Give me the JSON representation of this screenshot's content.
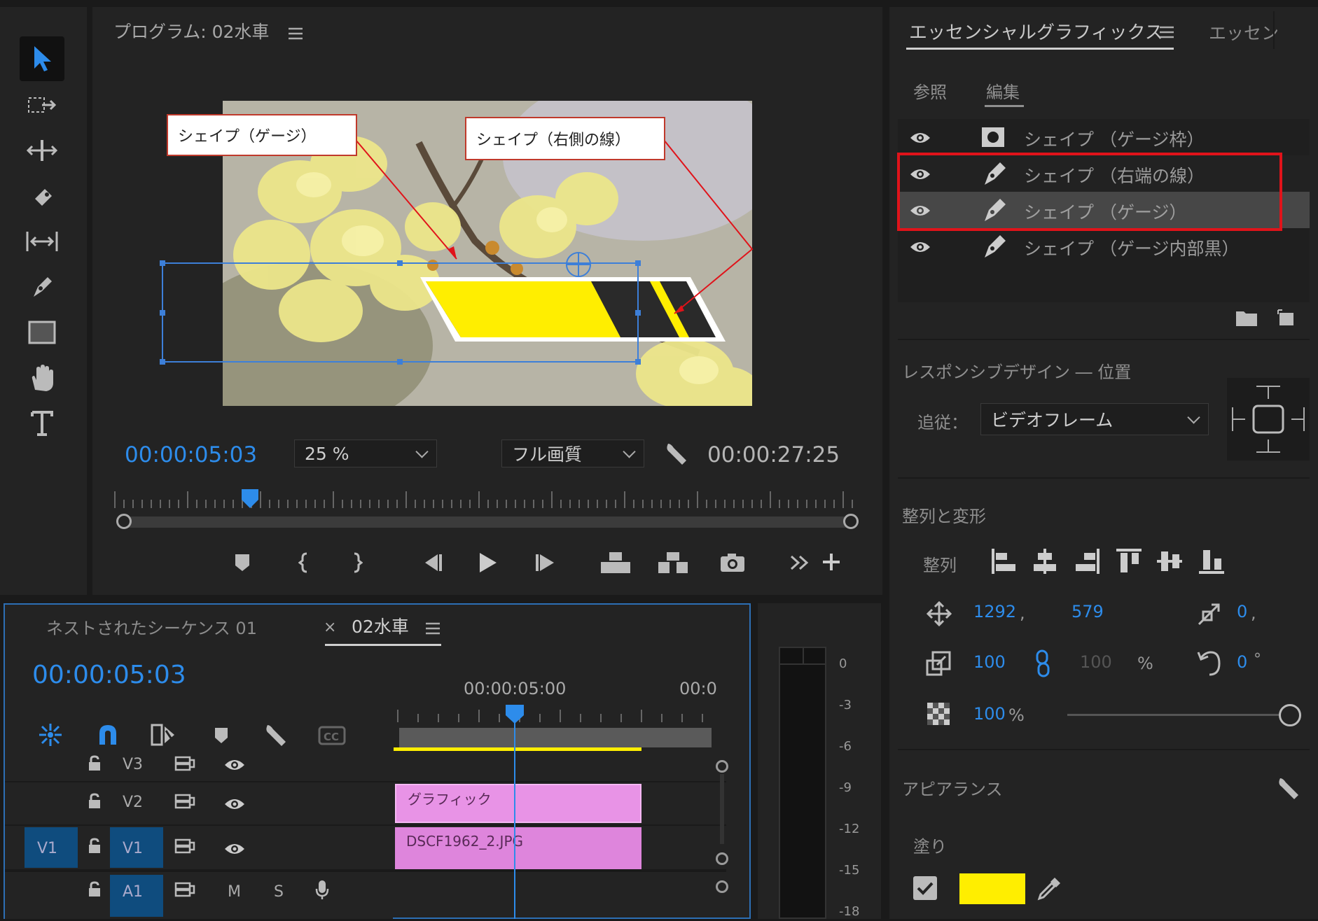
{
  "program": {
    "title": "プログラム: 02水車",
    "timecode": "00:00:05:03",
    "zoom": "25 %",
    "quality": "フル画質",
    "duration": "00:00:27:25",
    "playhead_fraction": 0.18
  },
  "callouts": {
    "gauge": "シェイプ（ゲージ）",
    "right_line": "シェイプ（右側の線）"
  },
  "essential": {
    "tab_main": "エッセンシャルグラフィックス",
    "tab_other": "エッセン",
    "subtab_browse": "参照",
    "subtab_edit": "編集",
    "layers": [
      {
        "name": "シェイプ （ゲージ枠）",
        "icon": "image-icon"
      },
      {
        "name": "シェイプ （右端の線）",
        "icon": "pen-icon"
      },
      {
        "name": "シェイプ （ゲージ）",
        "icon": "pen-icon"
      },
      {
        "name": "シェイプ （ゲージ内部黒）",
        "icon": "pen-icon"
      }
    ],
    "responsive_title": "レスポンシブデザイン ― 位置",
    "follow_label": "追従：",
    "follow_value": "ビデオフレーム",
    "align_title": "整列と変形",
    "align_label": "整列",
    "pos_x": "1292",
    "pos_sep": ",",
    "pos_y": "579",
    "anchor_x": "0",
    "anchor_sep": ",",
    "scale": "100",
    "scale_h": "100",
    "scale_unit": "%",
    "rotation": "0",
    "rotation_unit": "°",
    "opacity": "100",
    "opacity_unit": "%",
    "appearance_title": "アピアランス",
    "fill_label": "塗り",
    "fill_color": "#ffee00"
  },
  "timeline": {
    "tab_nested": "ネストされたシーケンス 01",
    "tab_close": "×",
    "tab_active": "02水車",
    "timecode": "00:00:05:03",
    "ruler_label_1": "00:00:05:00",
    "ruler_label_2": "00:0",
    "tracks": [
      {
        "target": "",
        "name": "V3",
        "type": "video"
      },
      {
        "target": "",
        "name": "V2",
        "type": "video"
      },
      {
        "target": "V1",
        "name": "V1",
        "type": "video"
      },
      {
        "target": "",
        "name": "A1",
        "type": "audio",
        "m": "M",
        "s": "S"
      }
    ],
    "clip_graphic": "グラフィック",
    "clip_image": "DSCF1962_2.JPG"
  },
  "meter": {
    "labels": [
      "0",
      "-3",
      "-6",
      "-9",
      "-12",
      "-15",
      "-18"
    ]
  },
  "colors": {
    "accent_blue": "#2d8ceb",
    "clip_pink": "#e38ae0",
    "highlight_red": "#e0131a",
    "gauge_yellow": "#ffee00"
  }
}
